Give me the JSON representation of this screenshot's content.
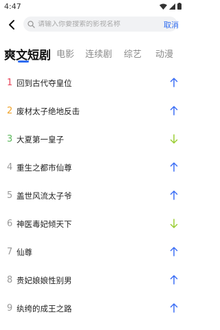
{
  "status": {
    "time": "4:47"
  },
  "header": {
    "search_placeholder": "请输入你要搜索的影视名称",
    "cancel_label": "取消"
  },
  "tabs": [
    {
      "label": "爽文短剧",
      "active": true
    },
    {
      "label": "电影",
      "active": false
    },
    {
      "label": "连续剧",
      "active": false
    },
    {
      "label": "综艺",
      "active": false
    },
    {
      "label": "动漫",
      "active": false
    }
  ],
  "colors": {
    "accent": "#2f6cf0",
    "rank1": "#e8455a",
    "rank2": "#f0a32a",
    "rank3": "#5cb85c",
    "trend_up": "#3b6ef5",
    "trend_down": "#9acd32"
  },
  "ranking": [
    {
      "rank": "1",
      "title": "回到古代夺皇位",
      "trend": "up"
    },
    {
      "rank": "2",
      "title": "废材太子绝地反击",
      "trend": "up"
    },
    {
      "rank": "3",
      "title": "大夏第一皇子",
      "trend": "down"
    },
    {
      "rank": "4",
      "title": "重生之都市仙尊",
      "trend": "up"
    },
    {
      "rank": "5",
      "title": "盖世风流太子爷",
      "trend": "up"
    },
    {
      "rank": "6",
      "title": "神医毒妃倾天下",
      "trend": "down"
    },
    {
      "rank": "7",
      "title": "仙尊",
      "trend": "up"
    },
    {
      "rank": "8",
      "title": "贵妃娘娘性别男",
      "trend": "up"
    },
    {
      "rank": "9",
      "title": "纨绔的成王之路",
      "trend": "up"
    }
  ]
}
